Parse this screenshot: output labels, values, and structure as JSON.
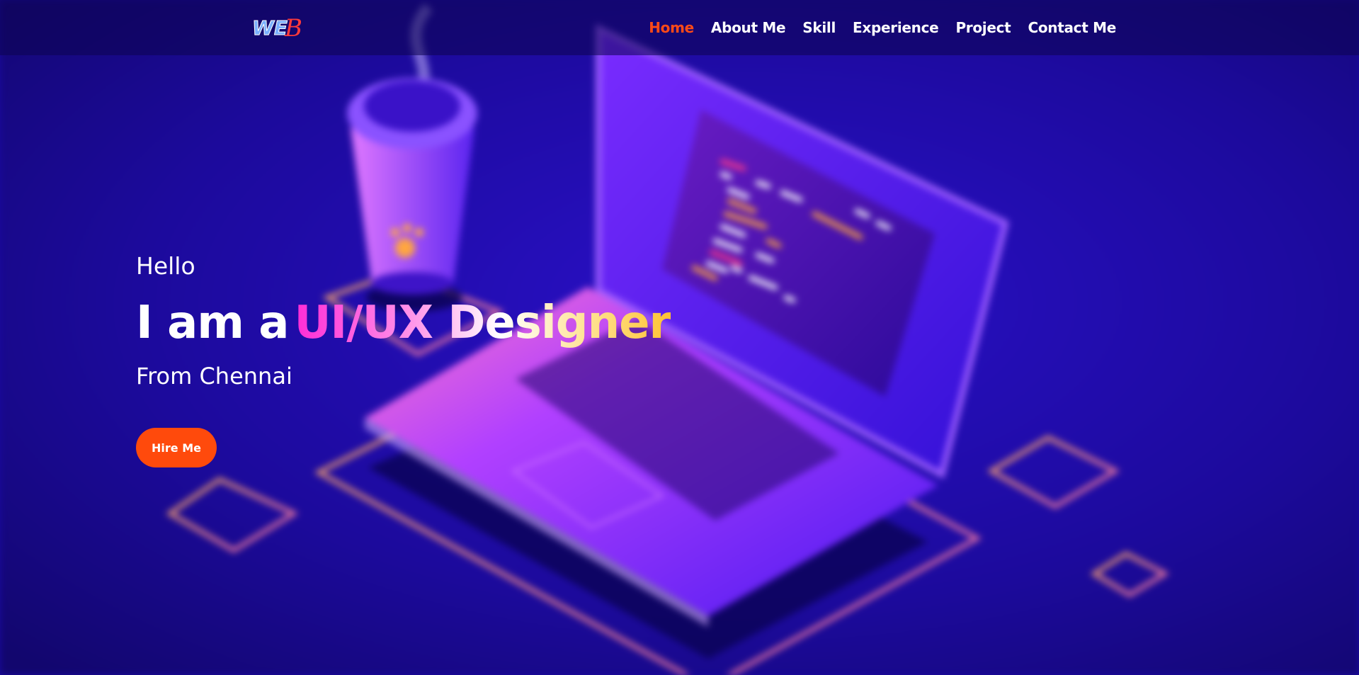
{
  "logo": {
    "text": "WEB"
  },
  "nav": {
    "items": [
      {
        "label": "Home",
        "active": true
      },
      {
        "label": "About Me",
        "active": false
      },
      {
        "label": "Skill",
        "active": false
      },
      {
        "label": "Experience",
        "active": false
      },
      {
        "label": "Project",
        "active": false
      },
      {
        "label": "Contact Me",
        "active": false
      }
    ]
  },
  "hero": {
    "greeting": "Hello",
    "headline_prefix": "I am a",
    "headline_role": "UI/UX Designer",
    "location": "From Chennai",
    "cta_label": "Hire Me"
  },
  "colors": {
    "accent": "#ff4a0c",
    "background": "#1a0aa0",
    "nav_active": "#ff4a17"
  },
  "illustration": [
    "coffee-cup",
    "laptop",
    "code-lines",
    "neon-diamonds"
  ]
}
